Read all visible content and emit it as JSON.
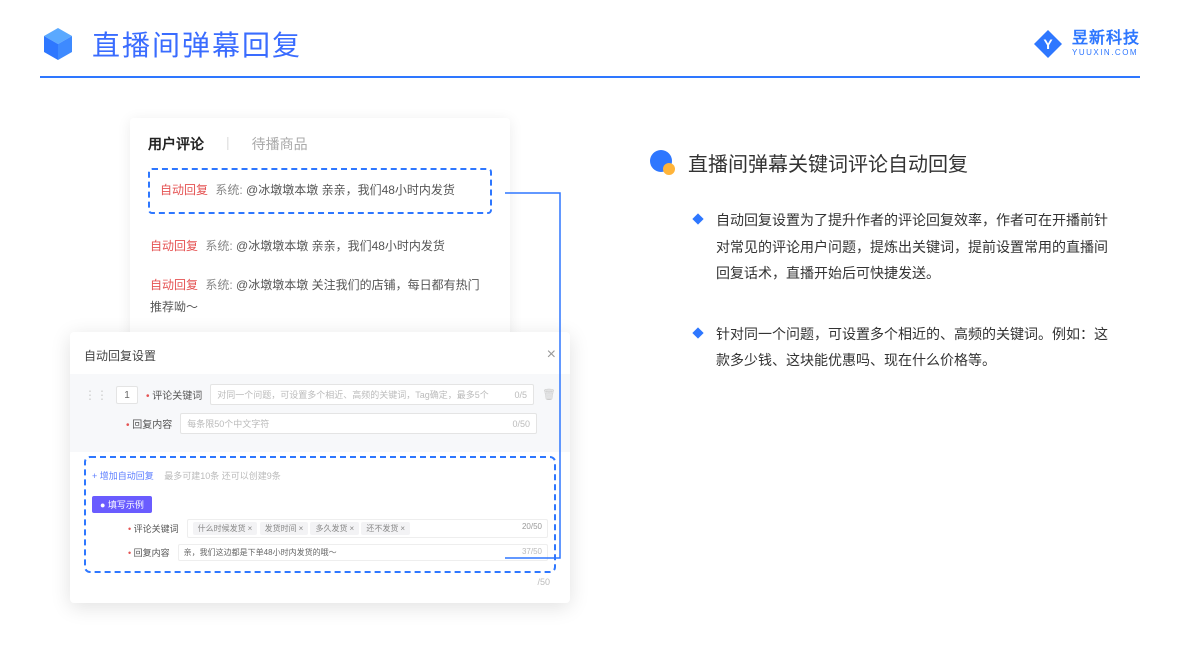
{
  "header": {
    "title": "直播间弹幕回复",
    "brand_cn": "昱新科技",
    "brand_en": "YUUXIN.COM"
  },
  "comments_card": {
    "tab_active": "用户评论",
    "tab_inactive": "待播商品",
    "items": [
      {
        "tag": "自动回复",
        "sys": "系统:",
        "text": "@冰墩墩本墩 亲亲，我们48小时内发货"
      },
      {
        "tag": "自动回复",
        "sys": "系统:",
        "text": "@冰墩墩本墩 亲亲，我们48小时内发货"
      },
      {
        "tag": "自动回复",
        "sys": "系统:",
        "text": "@冰墩墩本墩 关注我们的店铺，每日都有热门推荐呦～"
      }
    ]
  },
  "settings": {
    "dialog_title": "自动回复设置",
    "row_number": "1",
    "keyword_label": "评论关键词",
    "keyword_placeholder": "对同一个问题，可设置多个相近、高频的关键词，Tag确定，最多5个",
    "keyword_counter": "0/5",
    "content_label": "回复内容",
    "content_placeholder": "每条限50个中文字符",
    "content_counter": "0/50",
    "extra_counter": "/50",
    "add_link": "+ 增加自动回复",
    "add_hint": "最多可建10条 还可以创建9条",
    "example_pill": "● 填写示例",
    "ex_keyword_label": "评论关键词",
    "ex_tags": [
      "什么时候发货",
      "发货时间",
      "多久发货",
      "还不发货"
    ],
    "ex_kw_counter": "20/50",
    "ex_content_label": "回复内容",
    "ex_content_value": "亲，我们这边都是下单48小时内发货的哦～",
    "ex_content_counter": "37/50"
  },
  "right": {
    "section_title": "直播间弹幕关键词评论自动回复",
    "bullets": [
      "自动回复设置为了提升作者的评论回复效率，作者可在开播前针对常见的评论用户问题，提炼出关键词，提前设置常用的直播间回复话术，直播开始后可快捷发送。",
      "针对同一个问题，可设置多个相近的、高频的关键词。例如：这款多少钱、这块能优惠吗、现在什么价格等。"
    ]
  }
}
